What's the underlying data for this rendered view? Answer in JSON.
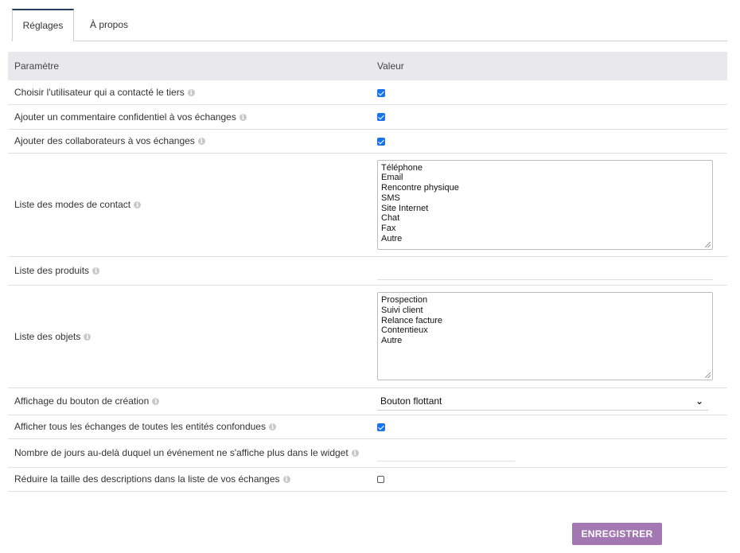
{
  "tabs": [
    {
      "label": "Réglages",
      "active": true
    },
    {
      "label": "À propos",
      "active": false
    }
  ],
  "table": {
    "headers": [
      "Paramètre",
      "Valeur"
    ],
    "rows": [
      {
        "label": "Choisir l'utilisateur qui a contacté le tiers",
        "type": "checkbox",
        "checked": true
      },
      {
        "label": "Ajouter un commentaire confidentiel à vos échanges",
        "type": "checkbox",
        "checked": true
      },
      {
        "label": "Ajouter des collaborateurs à vos échanges",
        "type": "checkbox",
        "checked": true
      },
      {
        "label": "Liste des modes de contact",
        "type": "list",
        "options": [
          "Téléphone",
          "Email",
          "Rencontre physique",
          "SMS",
          "Site Internet",
          "Chat",
          "Fax",
          "Autre"
        ]
      },
      {
        "label": "Liste des produits",
        "type": "text",
        "value": ""
      },
      {
        "label": "Liste des objets",
        "type": "list",
        "options": [
          "Prospection",
          "Suivi client",
          "Relance facture",
          "Contentieux",
          "Autre"
        ]
      },
      {
        "label": "Affichage du bouton de création",
        "type": "select",
        "value": "Bouton flottant"
      },
      {
        "label": "Afficher tous les échanges de toutes les entités confondues",
        "type": "checkbox",
        "checked": true
      },
      {
        "label": "Nombre de jours au-delà duquel un événement ne s'affiche plus dans le widget",
        "type": "number",
        "value": ""
      },
      {
        "label": "Réduire la taille des descriptions dans la liste de vos échanges",
        "type": "checkbox",
        "checked": false
      }
    ]
  },
  "save_button": {
    "label": "ENREGISTRER"
  },
  "info_icon": "info-icon",
  "colors": {
    "accent_button": "#a377b1",
    "checkbox": "#1a73e8",
    "header_bg": "#e9e9ec",
    "active_tab_border": "#263c5c"
  }
}
